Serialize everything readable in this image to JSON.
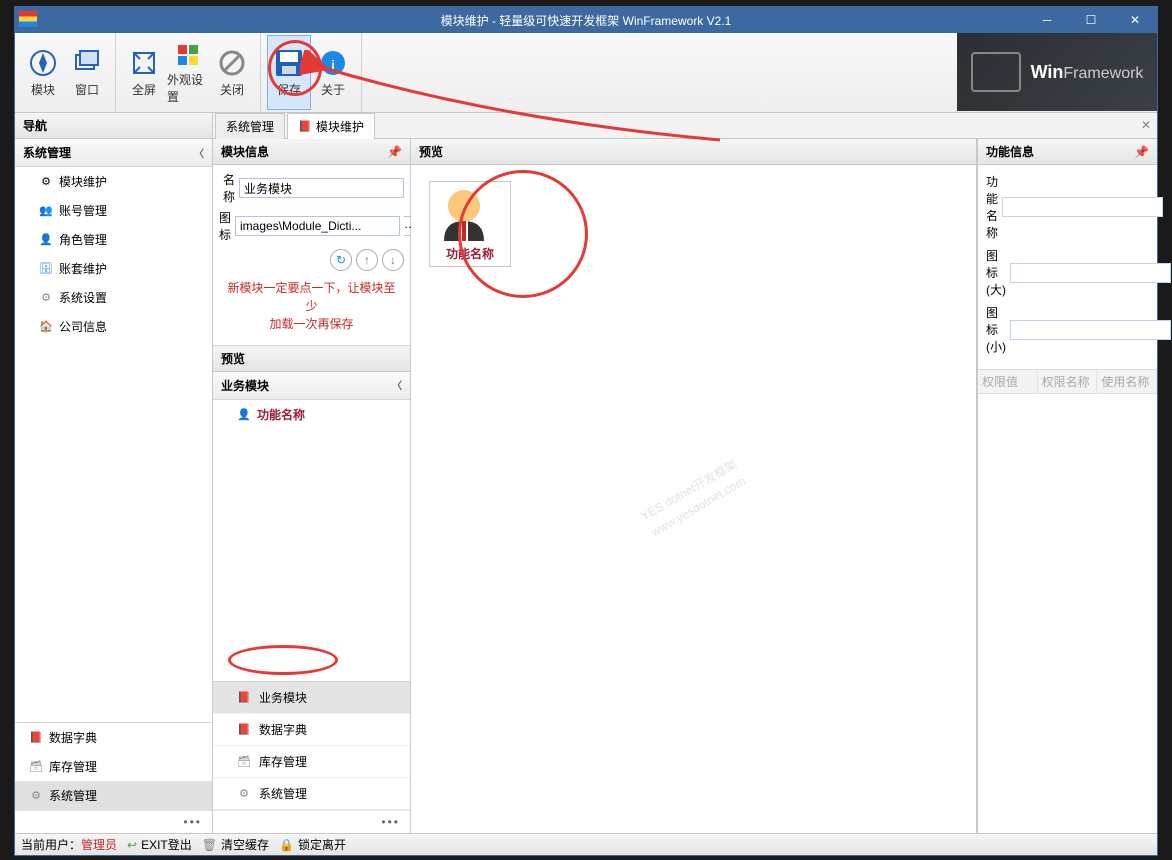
{
  "titlebar": {
    "title": "模块维护 - 轻量级可快速开发框架 WinFramework V2.1"
  },
  "ribbon": {
    "module": "模块",
    "window": "窗口",
    "fullscreen": "全屏",
    "appearance": "外观设置",
    "close": "关闭",
    "save": "保存",
    "about": "关于"
  },
  "brand": {
    "bold": "Win",
    "light": "Framework"
  },
  "nav": {
    "header": "导航",
    "section": "系统管理",
    "items": [
      "模块维护",
      "账号管理",
      "角色管理",
      "账套维护",
      "系统设置",
      "公司信息"
    ],
    "bottom": [
      "数据字典",
      "库存管理",
      "系统管理"
    ]
  },
  "tabs": {
    "t1": "系统管理",
    "t2": "模块维护"
  },
  "moduleInfo": {
    "header": "模块信息",
    "nameLabel": "名称",
    "nameValue": "业务模块",
    "iconLabel": "图标",
    "iconValue": "images\\Module_Dicti...",
    "hint1": "新模块一定要点一下，让模块至少",
    "hint2": "加载一次再保存"
  },
  "previewHeader": "预览",
  "tree": {
    "group": "业务模块",
    "item": "功能名称"
  },
  "bottomModules": [
    "业务模块",
    "数据字典",
    "库存管理",
    "系统管理"
  ],
  "centerPreview": {
    "label": "功能名称"
  },
  "watermark": {
    "line1": "YES dotnet开发框架",
    "line2": "www.yesdotnet.com"
  },
  "rightPanel": {
    "header": "功能信息",
    "nameLabel": "功能名称",
    "iconBig": "图标(大)",
    "iconSmall": "图标(小)",
    "cols": [
      "权限值",
      "权限名称",
      "使用名称"
    ]
  },
  "status": {
    "userLabel": "当前用户：",
    "userName": "管理员",
    "exit": "EXIT登出",
    "clearCache": "清空缓存",
    "lock": "锁定离开"
  }
}
